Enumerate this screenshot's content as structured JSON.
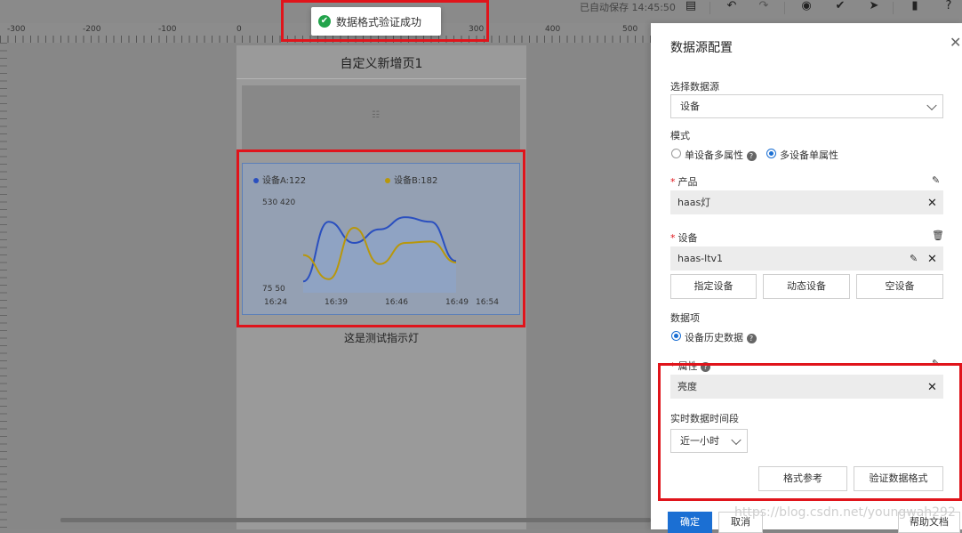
{
  "toolbar": {
    "autosave_text": "已自动保存 14:45:50",
    "icons": [
      "layers-icon",
      "undo-icon",
      "redo-icon",
      "preview-eye-icon",
      "check-circle-icon",
      "send-icon",
      "document-icon",
      "help-icon"
    ]
  },
  "ruler": {
    "labels": [
      "-300",
      "-200",
      "-100",
      "0",
      "300",
      "400",
      "500"
    ]
  },
  "toast": {
    "text": "数据格式验证成功",
    "icon": "check-circle-icon"
  },
  "page": {
    "title": "自定义新增页1",
    "placeholder_icon": "☷",
    "caption": "这是测试指示灯"
  },
  "chart_data": {
    "type": "line",
    "series": [
      {
        "name": "设备A:122",
        "color": "#2a4fbf",
        "values": [
          75,
          470,
          330,
          420,
          500,
          470,
          210
        ]
      },
      {
        "name": "设备B:182",
        "color": "#b8970b",
        "values": [
          250,
          90,
          430,
          190,
          330,
          340,
          200
        ]
      }
    ],
    "x_ticks": [
      "16:24",
      "16:39",
      "16:46",
      "16:49",
      "16:54"
    ],
    "y_top_labels": [
      "530",
      "420"
    ],
    "y_bottom_labels": [
      "75",
      "50"
    ],
    "area_fill": "#8ea3c6"
  },
  "panel": {
    "title": "数据源配置",
    "datasource_label": "选择数据源",
    "datasource_value": "设备",
    "mode_label": "模式",
    "mode_single": "单设备多属性",
    "mode_multi": "多设备单属性",
    "product_label": "产品",
    "product_value": "haas灯",
    "device_label": "设备",
    "device_value": "haas-ltv1",
    "btn_specify": "指定设备",
    "btn_dynamic": "动态设备",
    "btn_empty": "空设备",
    "data_item_label": "数据项",
    "data_item_history": "设备历史数据",
    "attr_label": "属性",
    "attr_value": "亮度",
    "realtime_label": "实时数据时间段",
    "realtime_value": "近一小时",
    "btn_format_ref": "格式参考",
    "btn_validate": "验证数据格式",
    "btn_confirm": "确定",
    "btn_cancel": "取消",
    "btn_help_doc": "帮助文档"
  },
  "watermark": "https://blog.csdn.net/youngwah292"
}
